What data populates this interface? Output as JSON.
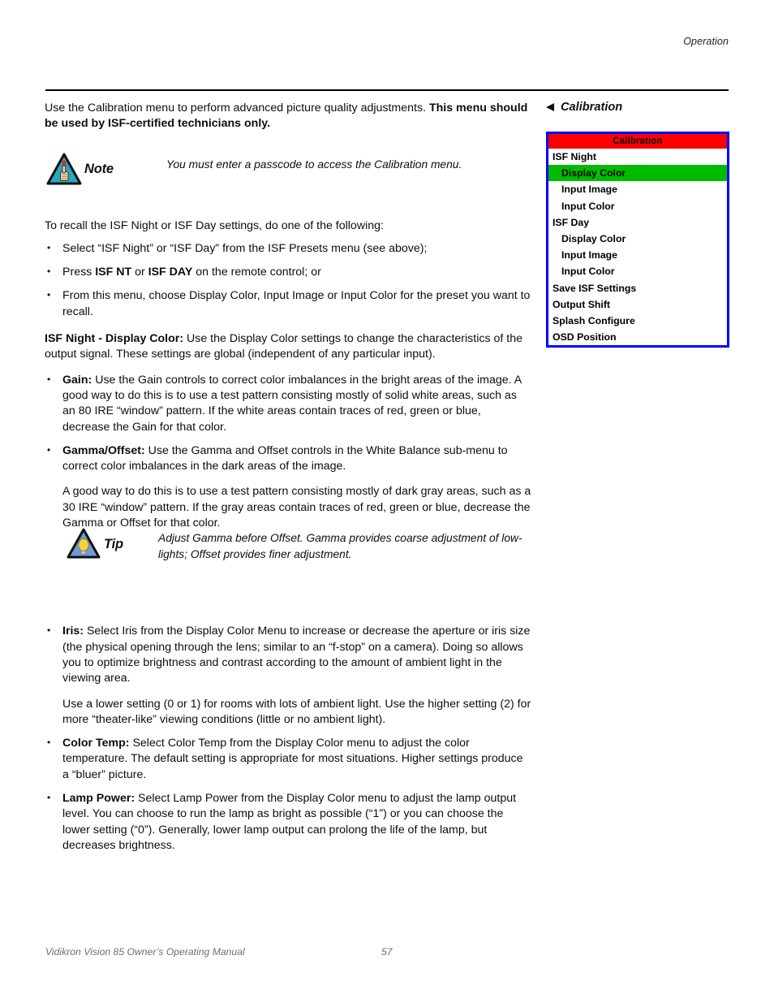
{
  "running_head": "Operation",
  "intro": {
    "text_plain": "Use the Calibration menu to perform advanced picture quality adjustments. ",
    "text_bold": "This menu should be used by ISF-certified technicians only."
  },
  "note": {
    "icon": "note-triangle-icon",
    "label": "Note",
    "text": "You must enter a passcode to access the Calibration menu."
  },
  "tip": {
    "icon": "tip-lightbulb-triangle-icon",
    "label": "Tip",
    "text": "Adjust Gamma before Offset. Gamma provides coarse adjustment of low-lights; Offset provides finer adjustment."
  },
  "recall": {
    "lead": "To recall the ISF Night or ISF Day settings, do one of the following:",
    "bullets": [
      {
        "parts": [
          {
            "style": "normal",
            "text": "Select “ISF Night” or “ISF Day” from the ISF Presets menu (see above);"
          }
        ]
      },
      {
        "parts": [
          {
            "style": "normal",
            "text": "Press "
          },
          {
            "style": "bold",
            "text": "ISF NT"
          },
          {
            "style": "normal",
            "text": " or "
          },
          {
            "style": "bold",
            "text": "ISF DAY"
          },
          {
            "style": "normal",
            "text": " on the remote control; or"
          }
        ]
      },
      {
        "parts": [
          {
            "style": "normal",
            "text": "From this menu, choose Display Color, Input Image or Input Color for the preset you want to recall."
          }
        ]
      }
    ]
  },
  "display_color": {
    "heading_bold": "ISF Night - Display Color:",
    "heading_rest": " Use the Display Color settings to change the characteristics of the output signal. These settings are global (independent of any particular input).",
    "items": [
      {
        "term": "Gain:",
        "text": " Use the Gain controls to correct color imbalances in the bright areas of the image. A good way to do this is to use a test pattern consisting mostly of solid white areas, such as an 80 IRE “window” pattern. If the white areas contain traces of red, green or blue, decrease the Gain for that color.",
        "extra": ""
      },
      {
        "term": "Gamma/Offset:",
        "text": " Use the Gamma and Offset controls in the White Balance sub-menu to correct color imbalances in the dark areas of the image.",
        "extra": "A good way to do this is to use a test pattern consisting mostly of dark gray areas, such as a 30 IRE “window” pattern. If the gray areas contain traces of red, green or blue, decrease the Gamma or Offset for that color."
      },
      {
        "term": "Iris:",
        "text": " Select Iris from the Display Color Menu to increase or decrease the aperture or iris size (the physical opening through the lens; similar to an “f-stop” on a camera). Doing so allows you to optimize brightness and contrast according to the amount of ambient light in the viewing area.",
        "extra": "Use a lower setting (0 or 1) for rooms with lots of ambient light. Use the higher setting (2) for more “theater-like” viewing conditions (little or no ambient light)."
      },
      {
        "term": "Color Temp:",
        "text": " Select Color Temp from the Display Color menu to adjust the color temperature. The default setting is appropriate for most situations. Higher settings produce a “bluer” picture.",
        "extra": ""
      },
      {
        "term": "Lamp Power:",
        "text": "  Select Lamp Power from the Display Color menu to adjust the lamp output level. You can choose to run the lamp as bright as possible (“1”) or you can choose the lower setting (“0”). Generally, lower lamp output can prolong the life of the lamp, but decreases brightness.",
        "extra": ""
      }
    ]
  },
  "sidebar": {
    "heading": "Calibration",
    "heading_icon": "triangle-left-icon",
    "osd": {
      "title": "Calibration",
      "title_bg": "#ff0000",
      "border_color": "#0000ff",
      "selected_bg": "#00bc00",
      "rows": [
        {
          "label": "ISF Night",
          "indent": false,
          "selected": false
        },
        {
          "label": "Display Color",
          "indent": true,
          "selected": true
        },
        {
          "label": "Input Image",
          "indent": true,
          "selected": false
        },
        {
          "label": "Input Color",
          "indent": true,
          "selected": false
        },
        {
          "label": "ISF Day",
          "indent": false,
          "selected": false
        },
        {
          "label": "Display Color",
          "indent": true,
          "selected": false
        },
        {
          "label": "Input Image",
          "indent": true,
          "selected": false
        },
        {
          "label": "Input Color",
          "indent": true,
          "selected": false
        },
        {
          "label": "Save ISF Settings",
          "indent": false,
          "selected": false
        },
        {
          "label": "Output Shift",
          "indent": false,
          "selected": false
        },
        {
          "label": "Splash Configure",
          "indent": false,
          "selected": false
        },
        {
          "label": "OSD Position",
          "indent": false,
          "selected": false
        }
      ]
    }
  },
  "footer": {
    "manual": "Vidikron Vision 85 Owner’s Operating Manual",
    "page": "57"
  }
}
